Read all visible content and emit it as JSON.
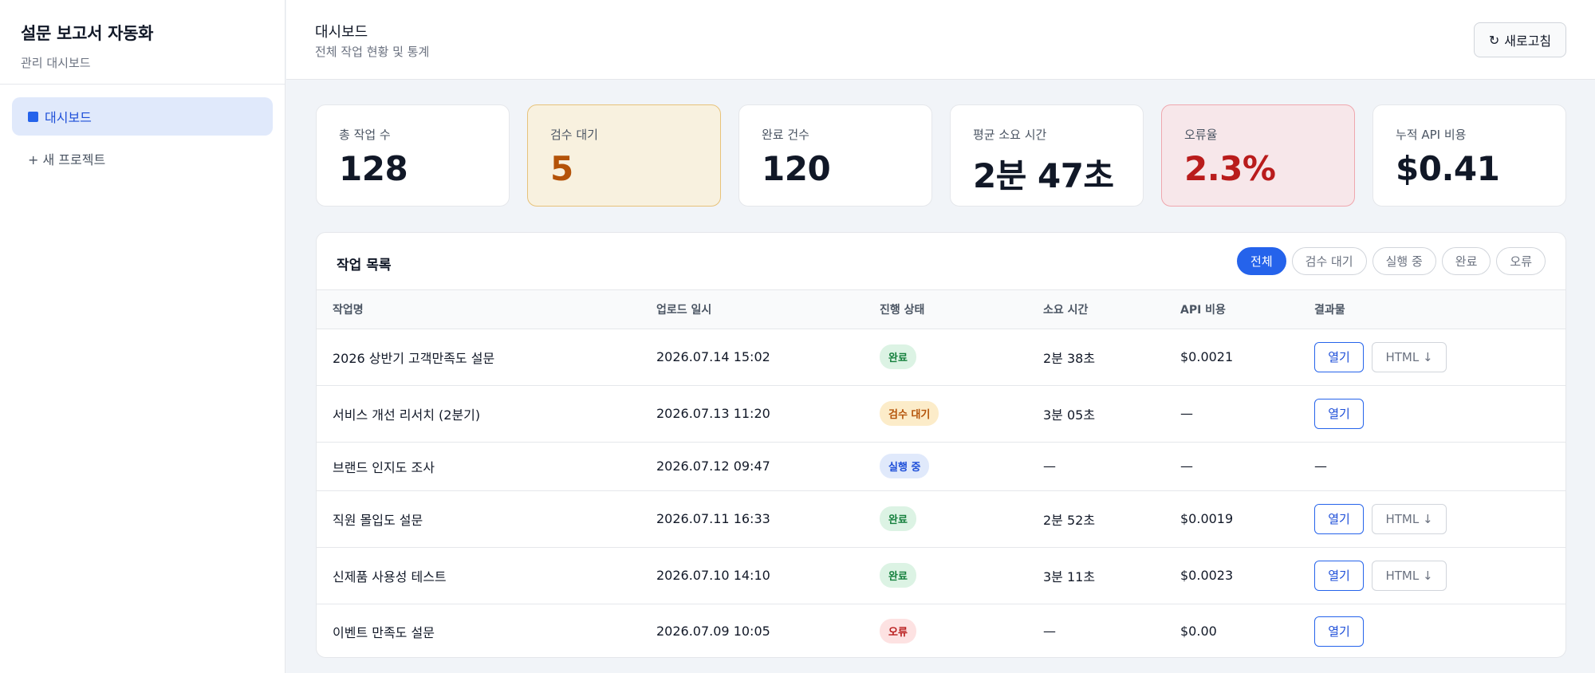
{
  "sidebar": {
    "title": "설문 보고서 자동화",
    "subtitle": "관리 대시보드",
    "items": [
      {
        "label": "대시보드"
      },
      {
        "label": "+ 새 프로젝트"
      }
    ]
  },
  "header": {
    "title": "대시보드",
    "subtitle": "전체 작업 현황 및 통계",
    "refresh_label": "새로고침",
    "refresh_icon": "↻"
  },
  "stats": [
    {
      "label": "총 작업 수",
      "value": "128"
    },
    {
      "label": "검수 대기",
      "value": "5"
    },
    {
      "label": "완료 건수",
      "value": "120"
    },
    {
      "label": "평균 소요 시간",
      "value": "2분 47초"
    },
    {
      "label": "오류율",
      "value": "2.3%"
    },
    {
      "label": "누적 API 비용",
      "value": "$0.41"
    }
  ],
  "tasks": {
    "title": "작업 목록",
    "filters": [
      "전체",
      "검수 대기",
      "실행 중",
      "완료",
      "오류"
    ],
    "columns": [
      "작업명",
      "업로드 일시",
      "진행 상태",
      "소요 시간",
      "API 비용",
      "결과물"
    ],
    "open_label": "열기",
    "html_label": "HTML ↓",
    "rows": [
      {
        "name": "2026 상반기 고객만족도 설문",
        "date": "2026.07.14 15:02",
        "status": "완료",
        "duration": "2분 38초",
        "cost": "$0.0021"
      },
      {
        "name": "서비스 개선 리서치 (2분기)",
        "date": "2026.07.13 11:20",
        "status": "검수 대기",
        "duration": "3분 05초",
        "cost": "—"
      },
      {
        "name": "브랜드 인지도 조사",
        "date": "2026.07.12 09:47",
        "status": "실행 중",
        "duration": "—",
        "cost": "—",
        "result": "—"
      },
      {
        "name": "직원 몰입도 설문",
        "date": "2026.07.11 16:33",
        "status": "완료",
        "duration": "2분 52초",
        "cost": "$0.0019"
      },
      {
        "name": "신제품 사용성 테스트",
        "date": "2026.07.10 14:10",
        "status": "완료",
        "duration": "3분 11초",
        "cost": "$0.0023"
      },
      {
        "name": "이벤트 만족도 설문",
        "date": "2026.07.09 10:05",
        "status": "오류",
        "duration": "—",
        "cost": "$0.00"
      }
    ]
  }
}
